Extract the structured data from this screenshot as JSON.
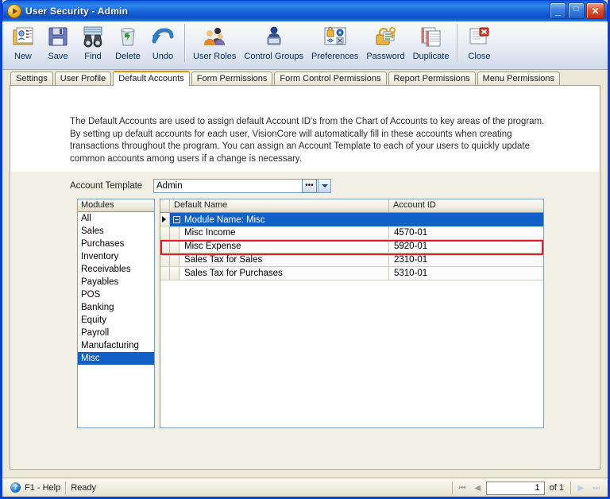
{
  "window": {
    "title": "User Security - Admin",
    "app_icon": "play-circle-icon",
    "buttons": {
      "minimize": "_",
      "maximize": "□",
      "close": "✕"
    }
  },
  "toolbar": {
    "items": [
      {
        "label": "New",
        "icon": "new-document-icon"
      },
      {
        "label": "Save",
        "icon": "floppy-disk-icon"
      },
      {
        "label": "Find",
        "icon": "binoculars-icon"
      },
      {
        "label": "Delete",
        "icon": "recycle-bin-icon"
      },
      {
        "label": "Undo",
        "icon": "undo-arrow-icon"
      },
      {
        "label": "User Roles",
        "icon": "users-group-icon"
      },
      {
        "label": "Control Groups",
        "icon": "control-group-icon"
      },
      {
        "label": "Preferences",
        "icon": "preferences-icon"
      },
      {
        "label": "Password",
        "icon": "padlock-key-icon"
      },
      {
        "label": "Duplicate",
        "icon": "duplicate-pages-icon"
      },
      {
        "label": "Close",
        "icon": "close-document-icon"
      }
    ]
  },
  "tabs": [
    {
      "label": "Settings",
      "active": false
    },
    {
      "label": "User Profile",
      "active": false
    },
    {
      "label": "Default Accounts",
      "active": true
    },
    {
      "label": "Form Permissions",
      "active": false
    },
    {
      "label": "Form Control Permissions",
      "active": false
    },
    {
      "label": "Report Permissions",
      "active": false
    },
    {
      "label": "Menu Permissions",
      "active": false
    }
  ],
  "content": {
    "description": "The Default Accounts are used to assign default Account ID's from the Chart of Accounts to key areas of the program.  By setting up default accounts for each user, VisionCore will automatically fill in these accounts when creating transactions throughout the program.  You can assign an Account Template to each of your users to quickly update common accounts among users if a change is necessary.",
    "account_template": {
      "label": "Account Template",
      "value": "Admin",
      "placeholder": "",
      "lookup_button": "•••",
      "dropdown_icon": "chevron-down-icon"
    },
    "modules": {
      "header": "Modules",
      "items": [
        {
          "label": "All",
          "selected": false
        },
        {
          "label": "Sales",
          "selected": false
        },
        {
          "label": "Purchases",
          "selected": false
        },
        {
          "label": "Inventory",
          "selected": false
        },
        {
          "label": "Receivables",
          "selected": false
        },
        {
          "label": "Payables",
          "selected": false
        },
        {
          "label": "POS",
          "selected": false
        },
        {
          "label": "Banking",
          "selected": false
        },
        {
          "label": "Equity",
          "selected": false
        },
        {
          "label": "Payroll",
          "selected": false
        },
        {
          "label": "Manufacturing",
          "selected": false
        },
        {
          "label": "Misc",
          "selected": true
        }
      ]
    },
    "grid": {
      "columns": [
        "Default Name",
        "Account ID"
      ],
      "group_row": {
        "label": "Module Name: Misc",
        "expander": "collapse-icon",
        "row_indicator": "current-row-arrow"
      },
      "rows": [
        {
          "name": "Misc Income",
          "account_id": "4570-01",
          "highlighted": false
        },
        {
          "name": "Misc Expense",
          "account_id": "5920-01",
          "highlighted": true
        },
        {
          "name": "Sales Tax for Sales",
          "account_id": "2310-01",
          "highlighted": false
        },
        {
          "name": "Sales Tax for Purchases",
          "account_id": "5310-01",
          "highlighted": false
        }
      ],
      "highlight_color": "#ed1c24"
    }
  },
  "statusbar": {
    "help_icon": "help-question-icon",
    "help_text": "F1 - Help",
    "status_text": "Ready",
    "nav": {
      "first": "⏮",
      "prev": "◀",
      "page": "1",
      "of_label": "of  1",
      "next": "▶",
      "last": "⏭"
    }
  },
  "colors": {
    "title_blue": "#1763d8",
    "accent_orange": "#e8920b",
    "selection_blue": "#1060c8",
    "panel_beige": "#ece9d8"
  }
}
